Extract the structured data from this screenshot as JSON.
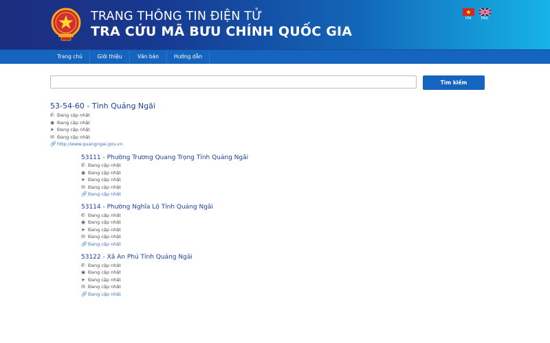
{
  "header": {
    "title_line1": "TRANG THÔNG TIN ĐIỆN TỬ",
    "title_line2": "TRA CỨU MÃ BƯU CHÍNH QUỐC GIA",
    "languages": [
      {
        "code": "VNI",
        "icon": "vietnam-flag-icon"
      },
      {
        "code": "ENG",
        "icon": "uk-flag-icon"
      }
    ],
    "emblem_icon": "national-emblem-icon"
  },
  "nav": {
    "items": [
      "Trang chủ",
      "Giới thiệu",
      "Văn bản",
      "Hướng dẫn"
    ]
  },
  "search": {
    "value": "",
    "placeholder": "",
    "button_label": "Tìm kiếm"
  },
  "colors": {
    "primary": "#1565c0",
    "title_link": "#1a3f9e",
    "link": "#3a6fc8"
  },
  "result": {
    "main": {
      "title": "53-54-60 - Tỉnh Quảng Ngãi",
      "phone": "Đang cập nhật",
      "location": "Đang cập nhật",
      "direction": "Đang cập nhật",
      "email": "Đang cập nhật",
      "website": "http://www.quangngai.gov.vn"
    },
    "children": [
      {
        "title": "53111 - Phường Trương Quang Trọng Tỉnh Quảng Ngãi",
        "phone": "Đang cập nhật",
        "location": "Đang cập nhật",
        "direction": "Đang cập nhật",
        "email": "Đang cập nhật",
        "website": "Đang cập nhật"
      },
      {
        "title": "53114 - Phường Nghĩa Lộ Tỉnh Quảng Ngãi",
        "phone": "Đang cập nhật",
        "location": "Đang cập nhật",
        "direction": "Đang cập nhật",
        "email": "Đang cập nhật",
        "website": "Đang cập nhật"
      },
      {
        "title": "53122 - Xã An Phú Tỉnh Quảng Ngãi",
        "phone": "Đang cập nhật",
        "location": "Đang cập nhật",
        "direction": "Đang cập nhật",
        "email": "Đang cập nhật",
        "website": "Đang cập nhật"
      }
    ],
    "icons": [
      "phone-icon",
      "map-marker-icon",
      "location-arrow-icon",
      "envelope-icon",
      "link-icon"
    ]
  }
}
